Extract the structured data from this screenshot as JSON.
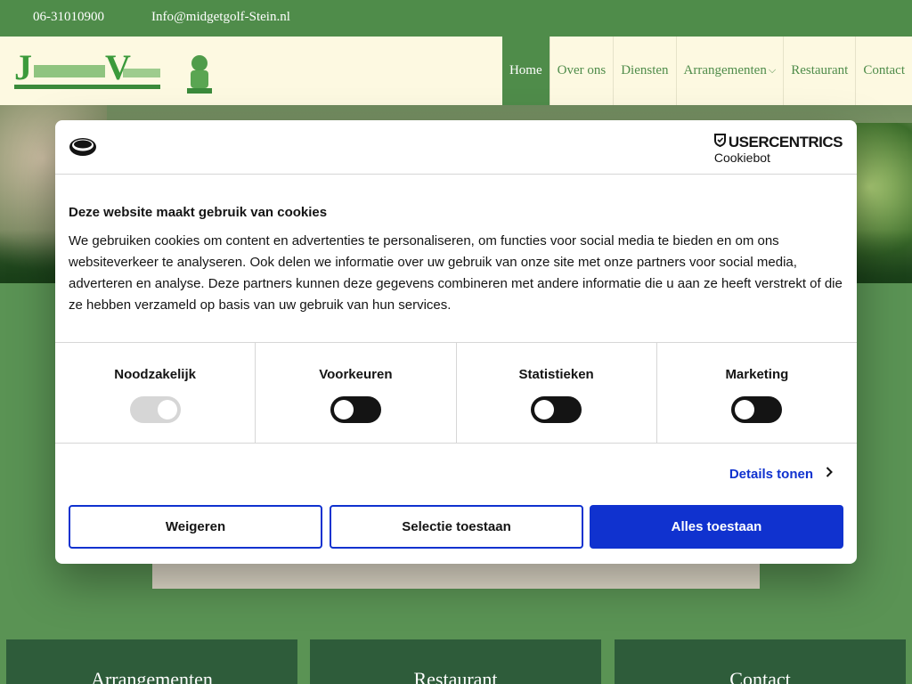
{
  "topbar": {
    "phone": "06-31010900",
    "email": "Info@midgetgolf-Stein.nl"
  },
  "nav": {
    "items": [
      {
        "label": "Home",
        "active": true
      },
      {
        "label": "Over ons"
      },
      {
        "label": "Diensten"
      },
      {
        "label": "Arrangementen",
        "has_dropdown": true
      },
      {
        "label": "Restaurant"
      },
      {
        "label": "Contact"
      }
    ]
  },
  "cards": [
    "Arrangementen",
    "Restaurant",
    "Contact"
  ],
  "cookie": {
    "brand": "USERCENTRICS",
    "brand_sub": "Cookiebot",
    "title": "Deze website maakt gebruik van cookies",
    "text": "We gebruiken cookies om content en advertenties te personaliseren, om functies voor social media te bieden en om ons websiteverkeer te analyseren. Ook delen we informatie over uw gebruik van onze site met onze partners voor social media, adverteren en analyse. Deze partners kunnen deze gegevens combineren met andere informatie die u aan ze heeft verstrekt of die ze hebben verzameld op basis van uw gebruik van hun services.",
    "categories": [
      {
        "label": "Noodzakelijk",
        "state": "on-disabled"
      },
      {
        "label": "Voorkeuren",
        "state": "off"
      },
      {
        "label": "Statistieken",
        "state": "off"
      },
      {
        "label": "Marketing",
        "state": "off"
      }
    ],
    "details_label": "Details tonen",
    "buttons": {
      "deny": "Weigeren",
      "selection": "Selectie toestaan",
      "allow_all": "Alles toestaan"
    }
  },
  "colors": {
    "site_green": "#4f8c4a",
    "header_cream": "#fdf9e1",
    "accent_blue": "#1032cf"
  }
}
